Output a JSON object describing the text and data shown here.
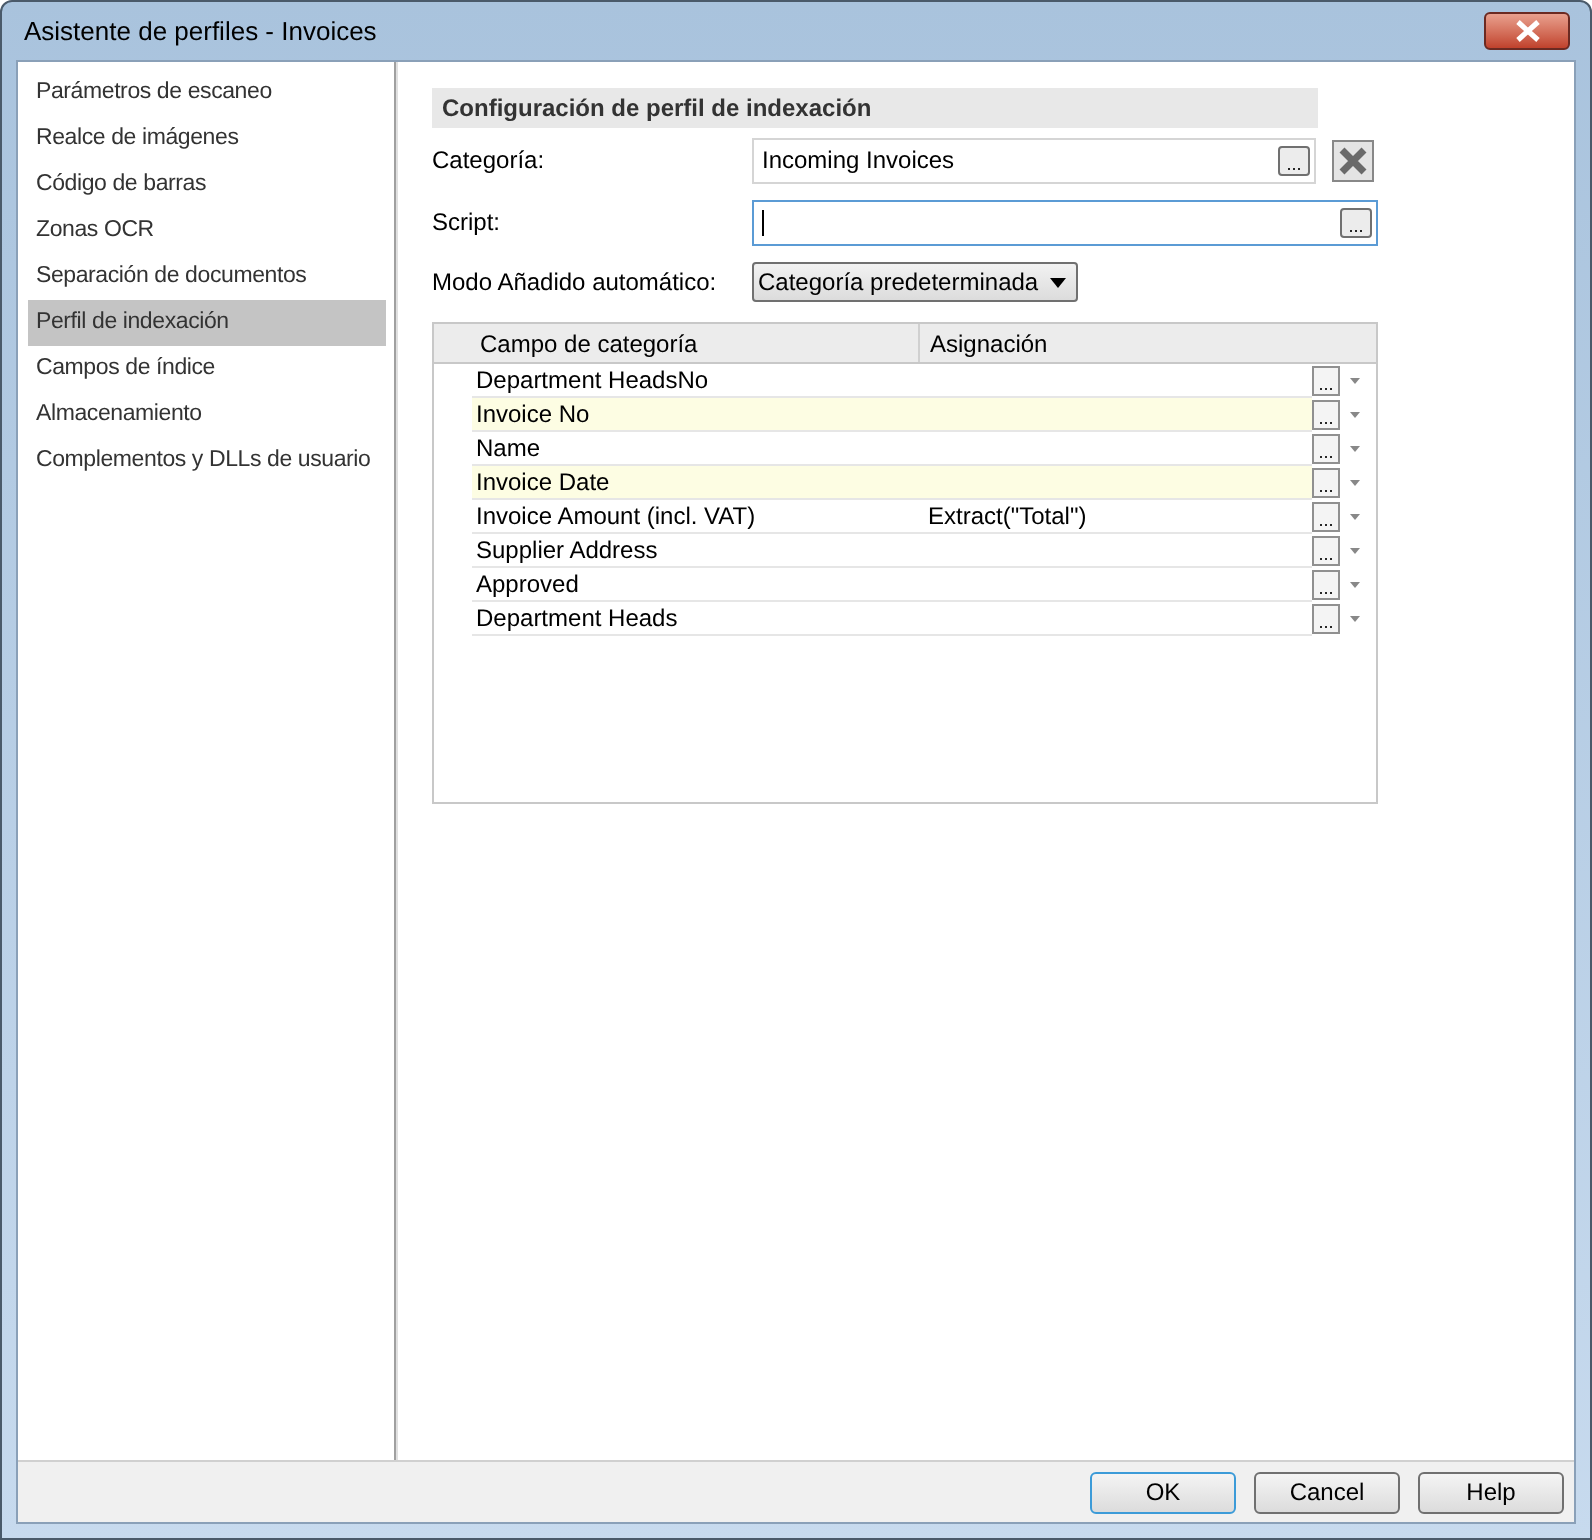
{
  "window": {
    "title": "Asistente de perfiles - Invoices"
  },
  "sidebar": {
    "items": [
      {
        "label": "Parámetros de escaneo",
        "selected": false
      },
      {
        "label": "Realce de imágenes",
        "selected": false
      },
      {
        "label": "Código de barras",
        "selected": false
      },
      {
        "label": "Zonas OCR",
        "selected": false
      },
      {
        "label": "Separación de documentos",
        "selected": false
      },
      {
        "label": "Perfil de indexación",
        "selected": true
      },
      {
        "label": "Campos de índice",
        "selected": false
      },
      {
        "label": "Almacenamiento",
        "selected": false
      },
      {
        "label": "Complementos y DLLs de usuario",
        "selected": false
      }
    ]
  },
  "section_title": "Configuración de perfil de indexación",
  "form": {
    "category": {
      "label": "Categoría:",
      "value": "Incoming Invoices",
      "browse": "..."
    },
    "script": {
      "label": "Script:",
      "browse": "..."
    },
    "auto_add_mode": {
      "label": "Modo Añadido automático:",
      "value": "Categoría predeterminada"
    }
  },
  "table": {
    "columns": [
      "Campo de categoría",
      "Asignación"
    ],
    "rows": [
      {
        "field": "Department HeadsNo",
        "highlighted": false,
        "browse": "..."
      },
      {
        "field": "Invoice No",
        "highlighted": true,
        "browse": "..."
      },
      {
        "field": "Name",
        "highlighted": false,
        "browse": "..."
      },
      {
        "field": "Invoice Date",
        "highlighted": true,
        "browse": "..."
      },
      {
        "field": "Invoice Amount (incl. VAT)",
        "assignment": "Extract(\"Total\")",
        "highlighted": false,
        "browse": "..."
      },
      {
        "field": "Supplier Address",
        "highlighted": false,
        "browse": "..."
      },
      {
        "field": "Approved",
        "highlighted": false,
        "browse": "..."
      },
      {
        "field": "Department Heads",
        "highlighted": false,
        "browse": "..."
      }
    ]
  },
  "buttons": [
    {
      "label": "OK",
      "default": true
    },
    {
      "label": "Cancel",
      "default": false
    },
    {
      "label": "Help",
      "default": false
    }
  ]
}
